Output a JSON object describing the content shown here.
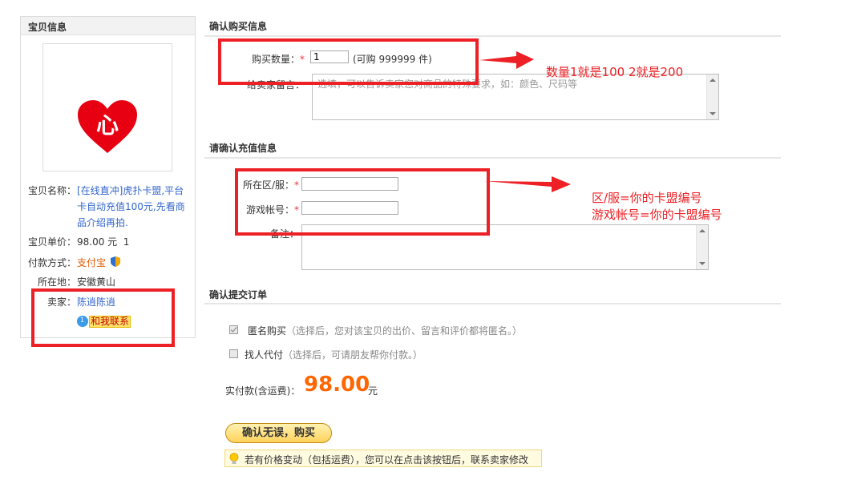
{
  "left": {
    "title": "宝贝信息",
    "name_label": "宝贝名称：",
    "name_value_lines": [
      "[在线直冲]虎扑卡盟,平台",
      "卡自动充值100元,先看商",
      "品介绍再拍."
    ],
    "price_label": "宝贝单价：",
    "price_value": "98.00 元  1",
    "payment_label": "付款方式：",
    "payment_value": "支付宝",
    "location_label": "所在地：",
    "location_value": "安徽黄山",
    "seller_label": "卖家：",
    "seller_value": "陈逍陈逍",
    "contact_label": "和我联系",
    "image_char": "心"
  },
  "section1": {
    "title": "确认购买信息",
    "quantity_label": "购买数量：",
    "quantity_value": "1",
    "quantity_hint": "(可购 999999 件)",
    "message_label": "给卖家留言：",
    "message_placeholder": "选填，可以告诉卖家您对商品的特殊要求，如：颜色、尺码等"
  },
  "section2": {
    "title": "请确认充值信息",
    "region_label": "所在区/服：",
    "account_label": "游戏帐号：",
    "note_label": "备注："
  },
  "section3": {
    "title": "确认提交订单",
    "anonymous_label": "匿名购买",
    "anonymous_hint": "（选择后，您对该宝贝的出价、留言和评价都将匿名。）",
    "proxy_label": "找人代付",
    "proxy_hint": "（选择后，可请朋友帮你付款。）",
    "total_label": "实付款(含运费)：",
    "total_value": "98.00",
    "total_unit": "元",
    "buy_button": "确认无误，购买",
    "tip": "若有价格变动（包括运费），您可以在点击该按钮后，联系卖家修改"
  },
  "annotations": {
    "note1": "数量1就是100  2就是200",
    "note2_line1": "区/服=你的卡盟编号",
    "note2_line2": "游戏帐号=你的卡盟编号"
  },
  "colors": {
    "annotation_red": "#ed2025",
    "price_orange": "#ff6600",
    "link_blue": "#3366cc"
  }
}
